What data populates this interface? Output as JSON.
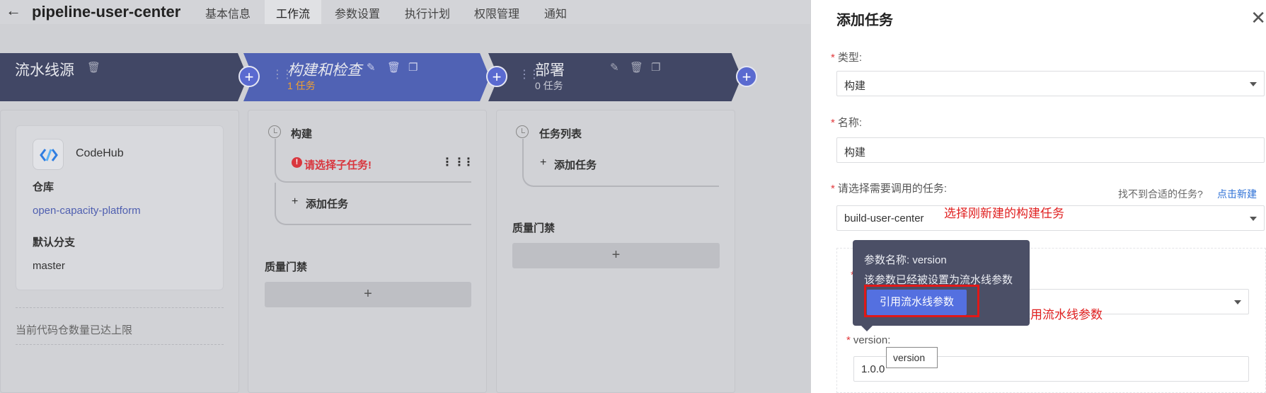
{
  "header": {
    "back_icon": "arrow-left-icon",
    "title": "pipeline-user-center",
    "tabs": [
      "基本信息",
      "工作流",
      "参数设置",
      "执行计划",
      "权限管理",
      "通知"
    ],
    "active_tab": "工作流"
  },
  "stages": [
    {
      "title": "流水线源"
    },
    {
      "title": "构建和检查",
      "subtitle": "1 任务"
    },
    {
      "title": "部署",
      "subtitle": "0 任务"
    }
  ],
  "source": {
    "name": "CodeHub",
    "repo_label": "仓库",
    "repo": "open-capacity-platform",
    "branch_label": "默认分支",
    "branch": "master",
    "limit_note": "当前代码仓数量已达上限"
  },
  "build_column": {
    "job_title": "构建",
    "error_text": "请选择子任务!",
    "add_task": "添加任务",
    "gate_title": "质量门禁",
    "gate_add": "+"
  },
  "deploy_column": {
    "job_title": "任务列表",
    "add_task": "添加任务",
    "gate_title": "质量门禁",
    "gate_add": "+"
  },
  "drawer": {
    "title": "添加任务",
    "type_label": "类型:",
    "type_value": "构建",
    "name_label": "名称:",
    "name_value": "构建",
    "task_label": "请选择需要调用的任务:",
    "task_hint": "找不到合适的任务?",
    "task_hint_link": "点击新建",
    "task_value": "build-user-center",
    "version_label": "version:",
    "version_value": "1.0.0"
  },
  "tooltip": {
    "param_name": "参数名称: version",
    "message": "该参数已经被设置为流水线参数",
    "button": "引用流水线参数"
  },
  "hover_tip": "version",
  "annotations": {
    "select_task": "选择刚新建的构建任务",
    "apply_param": "点击应用流水线参数"
  },
  "colors": {
    "stage_dark": "#414765",
    "stage_active": "#5062b4",
    "accent": "#5470e0",
    "error": "#d9363e",
    "annotation": "#e02020",
    "subtitle_orange": "#f0a030"
  }
}
